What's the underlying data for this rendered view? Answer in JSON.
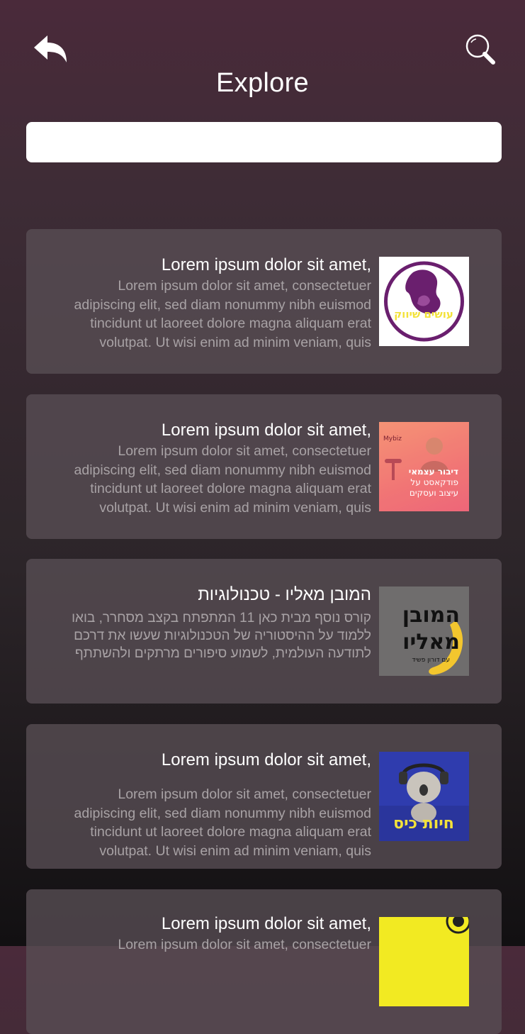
{
  "header": {
    "title": "Explore",
    "back_icon": "reply-arrow-icon",
    "search_icon": "magnifier-icon"
  },
  "search": {
    "value": "",
    "placeholder": ""
  },
  "colors": {
    "card_bg": "#5a4e54",
    "desc_text": "#a8a2a5",
    "thumb1_purple": "#6a1f6e",
    "thumb3_banana": "#f3c62e"
  },
  "items": [
    {
      "title": "Lorem ipsum dolor sit amet,",
      "desc": [
        "Lorem ipsum dolor sit amet, consectetuer",
        "adipiscing elit, sed diam nonummy nibh euismod",
        "tincidunt ut laoreet dolore magna aliquam erat",
        "volutpat. Ut wisi enim ad minim veniam, quis"
      ],
      "thumb_text": "עושים שיווק"
    },
    {
      "title": "Lorem ipsum dolor sit amet,",
      "desc": [
        "Lorem ipsum dolor sit amet, consectetuer",
        "adipiscing elit, sed diam nonummy nibh euismod",
        "tincidunt ut laoreet dolore magna aliquam erat",
        "volutpat. Ut wisi enim ad minim veniam, quis"
      ],
      "thumb_text": [
        "דיבור עצמאי",
        "פודקאסט על",
        "עיצוב ועסקים"
      ],
      "thumb_brand": "Mybiz"
    },
    {
      "title": "המובן מאליו - טכנולוגיות",
      "desc": [
        "קורס נוסף מבית כאן 11 המתפתח בקצב מסחרר, בואו",
        "ללמוד על ההיסטוריה של הטכנולוגיות שעשו את דרכם",
        "לתודעה העולמית, לשמוע סיפורים מרתקים ולהשתתף"
      ],
      "thumb_text": [
        "המובן",
        "מאליו"
      ],
      "thumb_sub": "עם דורון פשיד"
    },
    {
      "title": "Lorem ipsum dolor sit amet,",
      "desc": [
        "Lorem ipsum dolor sit amet, consectetuer",
        "adipiscing elit, sed diam nonummy nibh euismod",
        "tincidunt ut laoreet dolore magna aliquam erat",
        "volutpat. Ut wisi enim ad minim veniam, quis"
      ],
      "thumb_text": "חיות כיס"
    },
    {
      "title": "Lorem ipsum dolor sit amet,",
      "desc": [
        "Lorem ipsum dolor sit amet, consectetuer"
      ]
    }
  ]
}
